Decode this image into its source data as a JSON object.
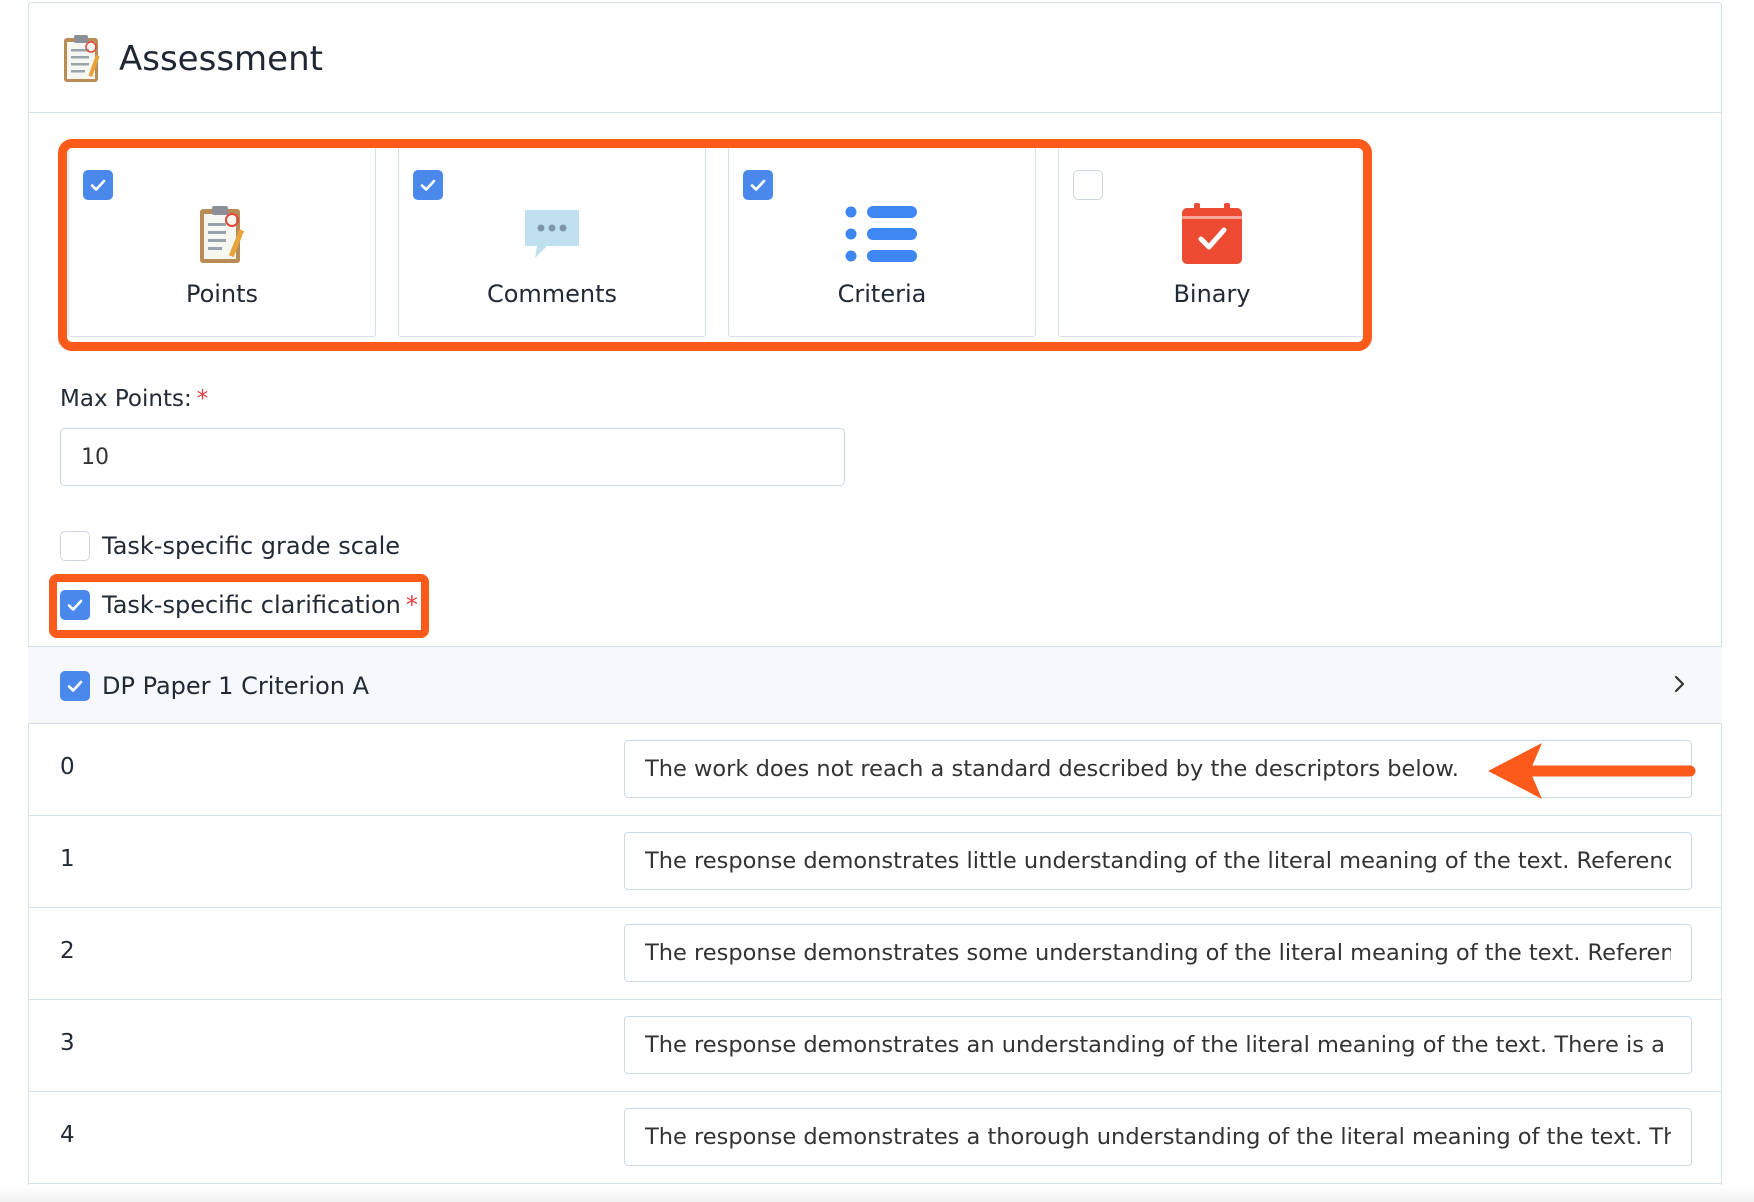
{
  "header": {
    "title": "Assessment",
    "icon": "assessment-clipboard-icon"
  },
  "modes": [
    {
      "label": "Points",
      "checked": true,
      "icon": "points-clipboard-icon"
    },
    {
      "label": "Comments",
      "checked": true,
      "icon": "comments-bubble-icon"
    },
    {
      "label": "Criteria",
      "checked": true,
      "icon": "criteria-list-icon"
    },
    {
      "label": "Binary",
      "checked": false,
      "icon": "binary-calendar-check-icon"
    }
  ],
  "max_points": {
    "label": "Max Points:",
    "required_mark": "*",
    "value": "10"
  },
  "options": {
    "grade_scale": {
      "label": "Task-specific grade scale",
      "checked": false
    },
    "clarification": {
      "label": "Task-specific clarification",
      "required_mark": "*",
      "checked": true
    }
  },
  "criterion": {
    "label": "DP Paper 1 Criterion A",
    "checked": true
  },
  "levels": [
    {
      "level": "0",
      "text": "The work does not reach a standard described by the descriptors below."
    },
    {
      "level": "1",
      "text": "The response demonstrates little understanding of the literal meaning of the text. Referenc"
    },
    {
      "level": "2",
      "text": "The response demonstrates some understanding of the literal meaning of the text. Referen"
    },
    {
      "level": "3",
      "text": "The response demonstrates an understanding of the literal meaning of the text. There is a s"
    },
    {
      "level": "4",
      "text": "The response demonstrates a thorough understanding of the literal meaning of the text. Th"
    }
  ],
  "colors": {
    "accent": "#4a88ec",
    "highlight": "#fb5a1b",
    "required": "#e23b3b",
    "border": "#d6e0ec"
  }
}
